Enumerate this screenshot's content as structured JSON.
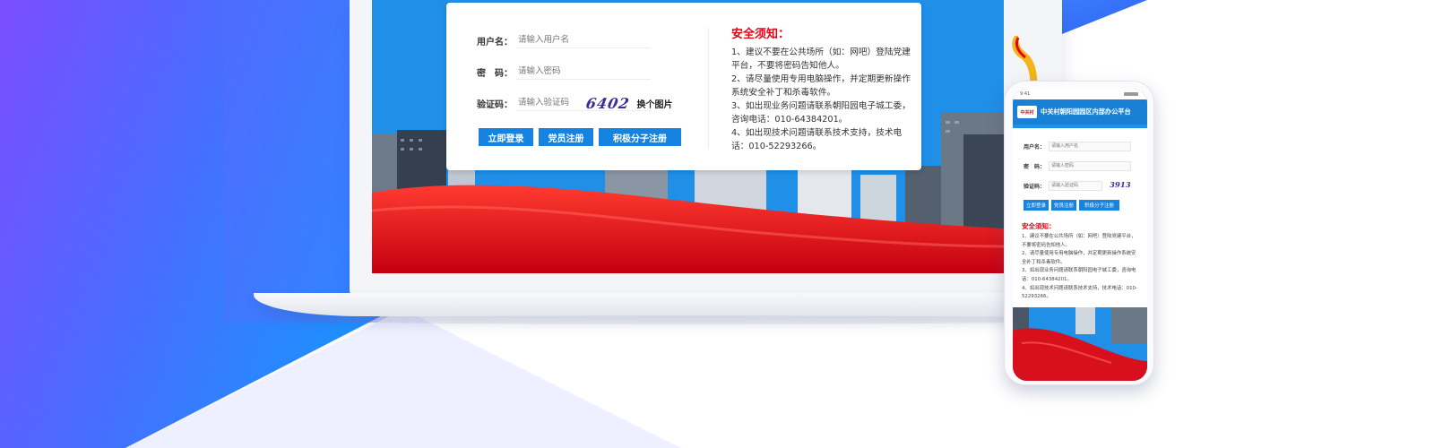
{
  "colors": {
    "brand_blue": "#1783e0",
    "notice_red": "#e60012",
    "bg_gradient_left": "#7b4dff",
    "bg_gradient_right": "#1e90ff"
  },
  "laptop": {
    "form": {
      "username_label": "用户名：",
      "username_placeholder": "请输入用户名",
      "password_label": "密　码：",
      "password_placeholder": "请输入密码",
      "captcha_label": "验证码：",
      "captcha_placeholder": "请输入验证码",
      "captcha_text": "6402",
      "captcha_refresh": "换个图片",
      "login_button": "立即登录",
      "member_register_button": "党员注册",
      "activist_register_button": "积极分子注册"
    },
    "notice": {
      "title": "安全须知：",
      "items": [
        "1、建议不要在公共场所（如：网吧）登陆党建平台，不要将密码告知他人。",
        "2、请尽量使用专用电脑操作，并定期更新操作系统安全补丁和杀毒软件。",
        "3、如出现业务问题请联系朝阳园电子城工委，咨询电话：010-64384201。",
        "4、如出现技术问题请联系技术支持，技术电话：010-52293266。"
      ]
    }
  },
  "phone": {
    "status_time": "9:41",
    "logo_text": "中关村",
    "title": "中关村朝阳园园区内部办公平台",
    "form": {
      "username_label": "用户名：",
      "username_placeholder": "请输入用户名",
      "password_label": "密　码：",
      "password_placeholder": "请输入密码",
      "captcha_label": "验证码：",
      "captcha_placeholder": "请输入验证码",
      "captcha_text": "3913",
      "login_button": "立即登录",
      "member_register_button": "党员注册",
      "activist_register_button": "积极分子注册"
    },
    "notice": {
      "title": "安全须知：",
      "items": [
        "1、建议不要在公共场所（如：网吧）登陆党建平台，不要将密码告知他人。",
        "2、请尽量使用专用电脑操作，并定期更新操作系统安全补丁和杀毒软件。",
        "3、如出现业务问题请联系朝阳园电子城工委，咨询电话：010-64384201。",
        "4、如出现技术问题请联系技术支持，技术电话：010-52293266。"
      ]
    }
  }
}
